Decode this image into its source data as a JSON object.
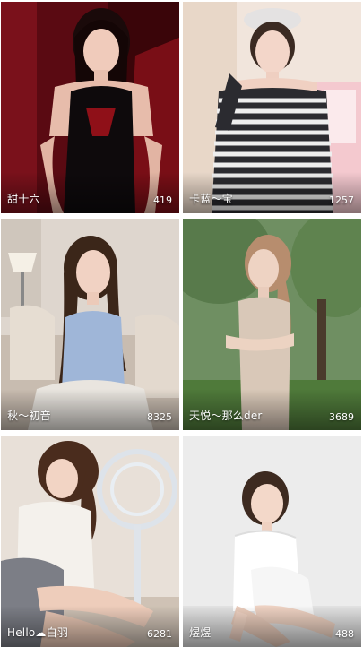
{
  "cards": [
    {
      "name": "甜十六",
      "count": "419"
    },
    {
      "name": "卡蓝～宝",
      "count": "1257"
    },
    {
      "name": "秋～初音",
      "count": "8325"
    },
    {
      "name": "天悦～那么der",
      "count": "3689"
    },
    {
      "name": "Hello☁白羽",
      "count": "6281"
    },
    {
      "name": "煜煜",
      "count": "488"
    }
  ]
}
